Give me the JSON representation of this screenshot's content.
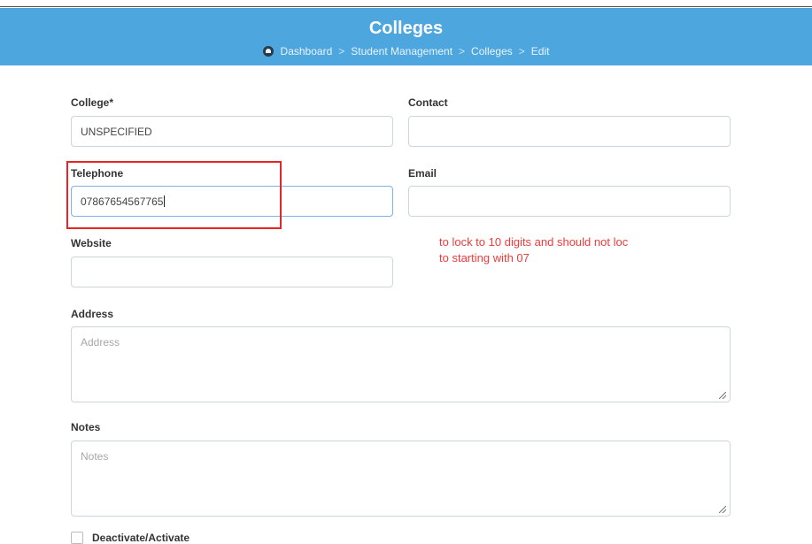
{
  "header": {
    "title": "Colleges",
    "breadcrumb": [
      "Dashboard",
      "Student Management",
      "Colleges",
      "Edit"
    ]
  },
  "form": {
    "college": {
      "label": "College*",
      "value": "UNSPECIFIED"
    },
    "contact": {
      "label": "Contact",
      "value": ""
    },
    "telephone": {
      "label": "Telephone",
      "value": "07867654567765"
    },
    "email": {
      "label": "Email",
      "value": ""
    },
    "website": {
      "label": "Website",
      "value": ""
    },
    "address": {
      "label": "Address",
      "placeholder": "Address"
    },
    "notes": {
      "label": "Notes",
      "placeholder": "Notes"
    },
    "deactivate": {
      "label": "Deactivate/Activate",
      "checked": false
    }
  },
  "annotation": {
    "line1": "to lock to 10  digits and should not loc",
    "line2": "to starting with 07",
    "color": "#ef3b3b"
  },
  "colors": {
    "header_bg": "#4ea6df",
    "annotation_border": "#e82525"
  }
}
